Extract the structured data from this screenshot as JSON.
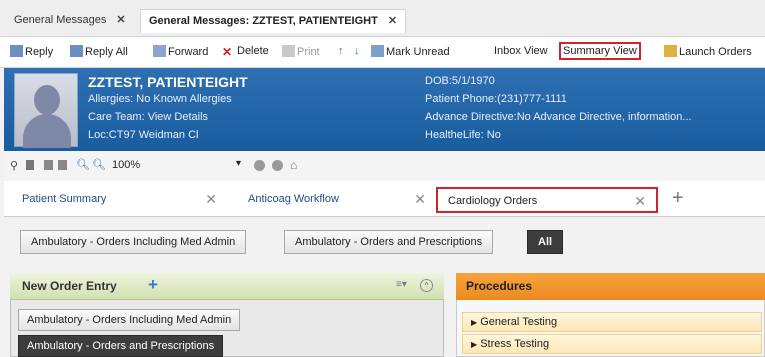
{
  "window_tabs": [
    {
      "label": "General Messages"
    },
    {
      "label": "General Messages: ZZTEST, PATIENTEIGHT"
    }
  ],
  "toolbar": {
    "reply": "Reply",
    "reply_all": "Reply All",
    "forward": "Forward",
    "delete": "Delete",
    "print": "Print",
    "mark_unread": "Mark Unread",
    "inbox_view": "Inbox View",
    "summary_view": "Summary View",
    "launch_orders": "Launch Orders"
  },
  "patient": {
    "name": "ZZTEST, PATIENTEIGHT",
    "allergies": "Allergies: No Known Allergies",
    "care_team": "Care Team: View Details",
    "location": "Loc:CT97 Weidman Cl",
    "dob": "DOB:5/1/1970",
    "phone": "Patient Phone:(231)777-1111",
    "advance_directive": "Advance Directive:No Advance Directive, information...",
    "healthelife": "HealtheLife: No"
  },
  "subtool": {
    "zoom": "100%"
  },
  "view_tabs": [
    {
      "label": "Patient Summary"
    },
    {
      "label": "Anticoag Workflow"
    },
    {
      "label": "Cardiology Orders"
    }
  ],
  "filters": [
    {
      "label": "Ambulatory - Orders Including Med Admin"
    },
    {
      "label": "Ambulatory - Orders and Prescriptions"
    },
    {
      "label": "All"
    }
  ],
  "new_order_entry": {
    "title": "New Order Entry",
    "items": [
      {
        "label": "Ambulatory - Orders Including Med Admin"
      },
      {
        "label": "Ambulatory - Orders and Prescriptions"
      }
    ]
  },
  "procedures": {
    "title": "Procedures",
    "items": [
      {
        "label": "General Testing"
      },
      {
        "label": "Stress Testing"
      }
    ]
  },
  "colors": {
    "banner": "#1f65a8",
    "highlight": "#d0242b",
    "procedures_header": "#ef8f25"
  }
}
